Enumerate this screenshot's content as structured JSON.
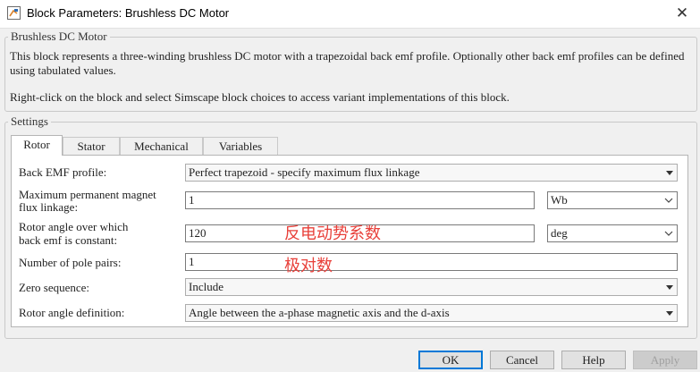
{
  "window": {
    "title": "Block Parameters: Brushless DC Motor",
    "close_glyph": "✕"
  },
  "description_group": {
    "legend": "Brushless DC Motor",
    "text1": "This block represents a three-winding brushless DC motor with a trapezoidal back emf profile. Optionally other back emf profiles can be defined using tabulated values.",
    "text2": "Right-click on the block and select Simscape block choices to access variant implementations of this block."
  },
  "settings_group": {
    "legend": "Settings"
  },
  "tabs": [
    {
      "label": "Rotor",
      "active": true
    },
    {
      "label": "Stator",
      "active": false
    },
    {
      "label": "Mechanical",
      "active": false
    },
    {
      "label": "Variables",
      "active": false
    }
  ],
  "params": {
    "back_emf": {
      "label": "Back EMF profile:",
      "value": "Perfect trapezoid - specify maximum flux linkage"
    },
    "max_flux": {
      "label1": "Maximum permanent magnet",
      "label2": "flux linkage:",
      "value": "1",
      "unit": "Wb"
    },
    "rotor_angle": {
      "label1": "Rotor angle over which",
      "label2": "back emf is constant:",
      "value": "120",
      "unit": "deg"
    },
    "pole_pairs": {
      "label": "Number of pole pairs:",
      "value": "1"
    },
    "zero_seq": {
      "label": "Zero sequence:",
      "value": "Include"
    },
    "angle_def": {
      "label": "Rotor angle definition:",
      "value": "Angle between the a-phase magnetic axis and the d-axis"
    }
  },
  "annotations": {
    "rotor_angle_note": "反电动势系数",
    "pole_pairs_note": "极对数"
  },
  "buttons": {
    "ok": "OK",
    "cancel": "Cancel",
    "help": "Help",
    "apply": "Apply"
  },
  "colors": {
    "annotation": "#e8403a",
    "default_button_border": "#0078d7"
  }
}
